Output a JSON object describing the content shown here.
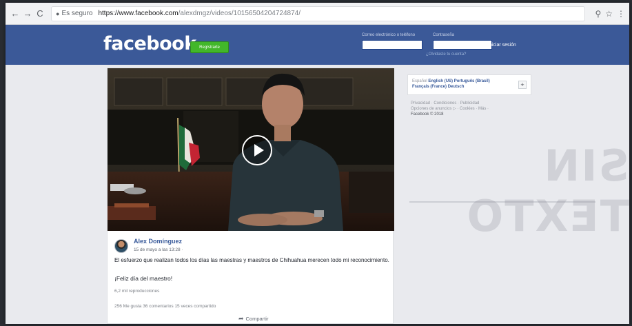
{
  "browser": {
    "back": "←",
    "forward": "→",
    "reload": "C",
    "secure_label": "Es seguro",
    "url_domain": "https://www.facebook.com",
    "url_path": "/alexdmgz/videos/10156504204724874/",
    "icons": [
      "back-arrow-icon",
      "forward-arrow-icon",
      "reload-icon",
      "lock-icon",
      "zoom-icon",
      "star-icon",
      "menu-icon"
    ]
  },
  "header": {
    "logo": "facebook",
    "register_label": "Regístrarte",
    "email_label": "Correo electrónico o teléfono",
    "password_label": "Contraseña",
    "login_label": "Iniciar sesión",
    "forgot_label": "¿Olvidaste tu cuenta?",
    "brand_color": "#3b5998",
    "register_color": "#42b72a"
  },
  "post": {
    "author": "Alex Domínguez",
    "date": "15 de mayo a las 13:28 · ",
    "text": "El esfuerzo que realizan todos los días las maestras y maestros de Chihuahua merecen todo mi reconocimiento.",
    "text2": "¡Feliz día del maestro!",
    "views": "6,2 mil reproducciones",
    "stats": "256 Me gusta   36 comentarios   15 veces compartido",
    "share_label": "Compartir"
  },
  "sidebar": {
    "lang_es": "Español",
    "lang_en": "English (US)",
    "lang_pt": "Português (Brasil)",
    "lang_fr": "Français (France)",
    "lang_de": "Deutsch",
    "lang_plus": "+",
    "footer_line1": "Privacidad · Condiciones · Publicidad",
    "footer_line2": "Opciones de anuncios ▷ · Cookies · Más ·",
    "copyright": "Facebook © 2018"
  },
  "background_text": "SIN TEXTO"
}
